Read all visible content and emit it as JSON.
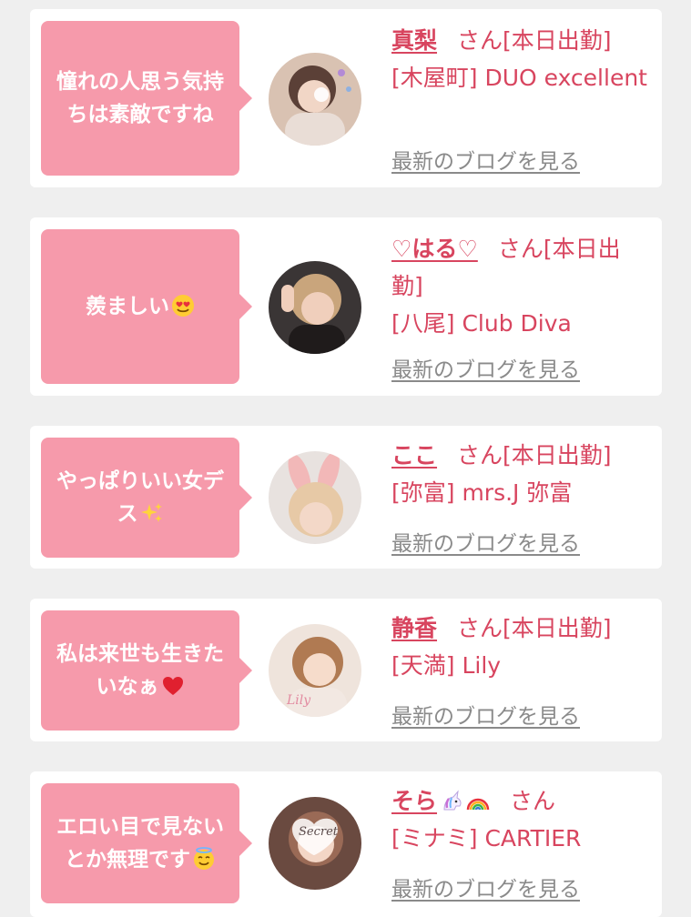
{
  "cards": [
    {
      "message": "憧れの人思う気持ちは素敵ですね",
      "emoji_icon": "",
      "name": "真梨",
      "suffix": "さん[本日出勤]",
      "shop": "[木屋町] DUO excellent",
      "blog_link": "最新のブログを見る"
    },
    {
      "message": "羨ましい",
      "emoji_icon": "heart-eyes-emoji-icon",
      "name": "♡はる♡",
      "suffix": "さん[本日出勤]",
      "shop": "[八尾] Club Diva",
      "blog_link": "最新のブログを見る"
    },
    {
      "message": "やっぱりいい女デス",
      "emoji_icon": "sparkles-emoji-icon",
      "name": "ここ",
      "suffix": "さん[本日出勤]",
      "shop": "[弥富] mrs.J 弥富",
      "blog_link": "最新のブログを見る"
    },
    {
      "message": "私は来世も生きたいなぁ",
      "emoji_icon": "red-heart-emoji-icon",
      "name": "静香",
      "suffix": "さん[本日出勤]",
      "shop": "[天満] Lily",
      "blog_link": "最新のブログを見る"
    },
    {
      "message": "エロい目で見ないとか無理です",
      "emoji_icon": "halo-smile-emoji-icon",
      "name": "そら",
      "name_icons": [
        "unicorn-emoji-icon",
        "rainbow-emoji-icon"
      ],
      "suffix": "さん",
      "shop": "[ミナミ] CARTIER",
      "blog_link": "最新のブログを見る"
    }
  ],
  "colors": {
    "background": "#efefef",
    "card": "#ffffff",
    "bubble": "#f69aab",
    "accent": "#d8455f",
    "link_gray": "#8a8a8a"
  }
}
